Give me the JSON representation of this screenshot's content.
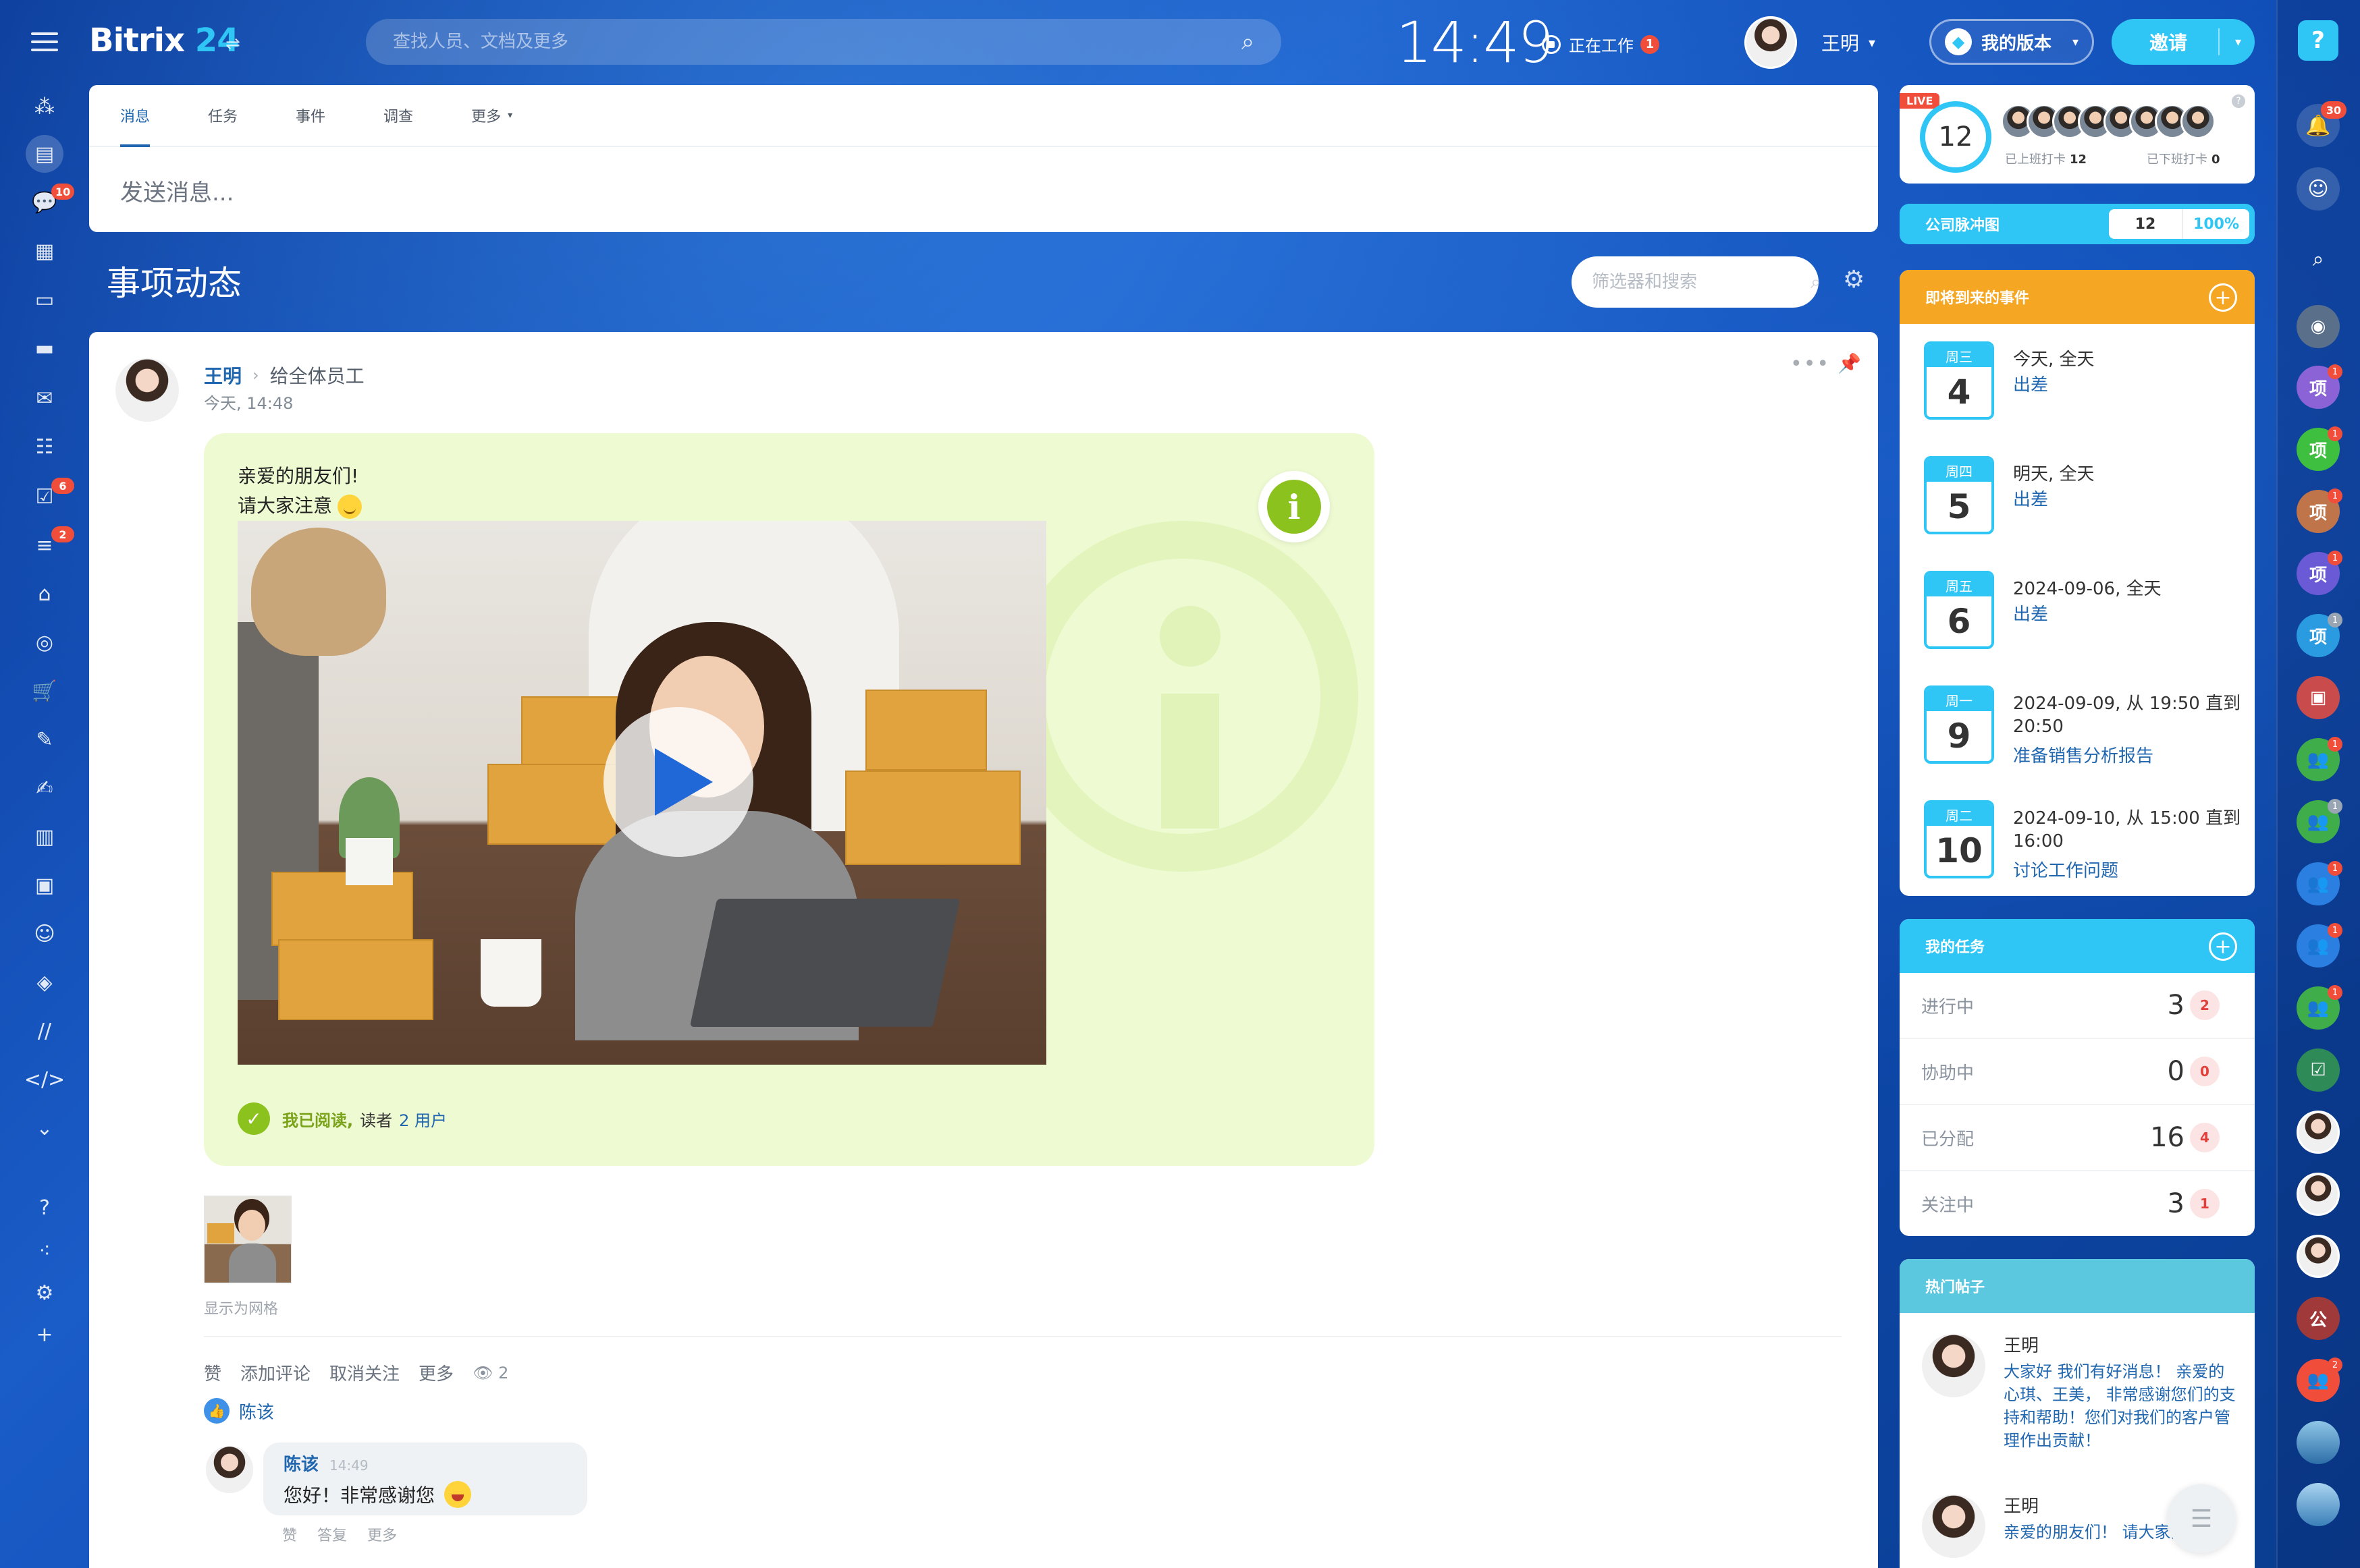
{
  "header": {
    "logo_text": "Bitrix",
    "logo_num": "24",
    "search_placeholder": "查找人员、文档及更多",
    "clock": "14:49",
    "work_status": "正在工作",
    "work_status_badge": "1",
    "user_name": "王明",
    "my_version": "我的版本",
    "invite": "邀请"
  },
  "left_rail": {
    "badges": {
      "chat": "10",
      "tasks": "6",
      "crm": "2"
    }
  },
  "composer": {
    "tabs": [
      {
        "label": "消息"
      },
      {
        "label": "任务"
      },
      {
        "label": "事件"
      },
      {
        "label": "调查"
      },
      {
        "label": "更多"
      }
    ],
    "input_placeholder": "发送消息..."
  },
  "feed": {
    "title": "事项动态",
    "filter_placeholder": "筛选器和搜索"
  },
  "post": {
    "author": "王明",
    "destination": "给全体员工",
    "time": "今天, 14:48",
    "greeting_line1": "亲爱的朋友们!",
    "greeting_line2": "请大家注意",
    "read_label": "我已阅读,",
    "readers_label": "读者",
    "readers_link": "2 用户",
    "show_as_grid": "显示为网格",
    "actions": {
      "like": "赞",
      "comment": "添加评论",
      "unfollow": "取消关注",
      "more": "更多",
      "views": "2"
    },
    "liked_by": "陈该",
    "comment": {
      "name": "陈该",
      "time": "14:49",
      "text": "您好！非常感谢您",
      "actions": [
        "赞",
        "答复",
        "更多"
      ]
    }
  },
  "stafftrack": {
    "live": "LIVE",
    "count": "12",
    "checked_in_label": "已上班打卡",
    "checked_in": "12",
    "checked_out_label": "已下班打卡",
    "checked_out": "0"
  },
  "pulse": {
    "label": "公司脉冲图",
    "value": "12",
    "percent": "100%"
  },
  "events": {
    "title": "即将到来的事件",
    "items": [
      {
        "dow": "周三",
        "day": "4",
        "when": "今天, 全天",
        "title": "出差"
      },
      {
        "dow": "周四",
        "day": "5",
        "when": "明天, 全天",
        "title": "出差"
      },
      {
        "dow": "周五",
        "day": "6",
        "when": "2024-09-06, 全天",
        "title": "出差"
      },
      {
        "dow": "周一",
        "day": "9",
        "when": "2024-09-09, 从 19:50 直到 20:50",
        "title": "准备销售分析报告"
      },
      {
        "dow": "周二",
        "day": "10",
        "when": "2024-09-10, 从 15:00 直到 16:00",
        "title": "讨论工作问题"
      }
    ]
  },
  "tasks": {
    "title": "我的任务",
    "rows": [
      {
        "label": "进行中",
        "count": "3",
        "badge": "2"
      },
      {
        "label": "协助中",
        "count": "0",
        "badge": "0"
      },
      {
        "label": "已分配",
        "count": "16",
        "badge": "4"
      },
      {
        "label": "关注中",
        "count": "3",
        "badge": "1"
      }
    ]
  },
  "popular": {
    "title": "热门帖子",
    "items": [
      {
        "name": "王明",
        "text": "大家好 我们有好消息！ 亲爱的心琪、王美， 非常感谢您们的支持和帮助！您们对我们的客户管理作出贡献！"
      },
      {
        "name": "王明",
        "text": "亲爱的朋友们！ 请大家注意"
      }
    ]
  },
  "right_rail": {
    "notifications_badge": "30",
    "chat_badges": [
      "1",
      "1",
      "1",
      "1",
      "1",
      "1",
      "1",
      "1",
      "1",
      "1",
      "1",
      "2"
    ],
    "group_label": "项",
    "company_label": "公"
  },
  "colors": {
    "accent": "#2fc6f6",
    "link": "#2067b0",
    "events": "#f5a623",
    "announce": "#eefad2",
    "badge": "#f04d3a"
  }
}
